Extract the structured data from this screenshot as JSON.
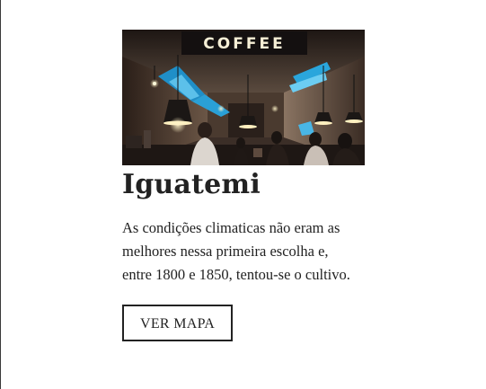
{
  "card": {
    "image_sign_text": "COFFEE",
    "title": "Iguatemi",
    "description": "As condições climaticas não eram as melhores nessa primeira escolha e, entre 1800 e 1850, tentou-se o cultivo.",
    "button_label": "VER MAPA"
  },
  "colors": {
    "text": "#222222",
    "button_border": "#222222",
    "background": "#ffffff"
  }
}
